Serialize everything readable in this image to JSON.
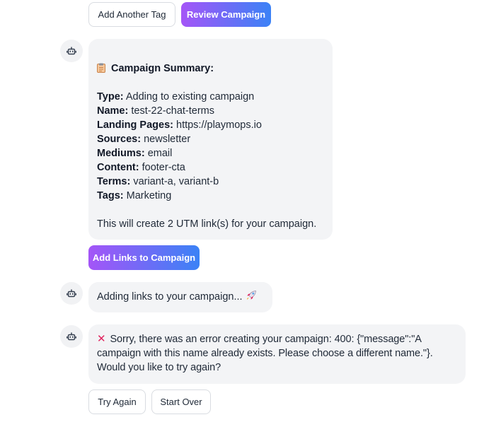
{
  "top_actions": {
    "add_tag_label": "Add Another Tag",
    "review_label": "Review Campaign"
  },
  "summary": {
    "title": "Campaign Summary:",
    "fields": [
      {
        "label": "Type:",
        "value": "Adding to existing campaign"
      },
      {
        "label": "Name:",
        "value": "test-22-chat-terms"
      },
      {
        "label": "Landing Pages:",
        "value": "https://playmops.io"
      },
      {
        "label": "Sources:",
        "value": "newsletter"
      },
      {
        "label": "Mediums:",
        "value": "email"
      },
      {
        "label": "Content:",
        "value": "footer-cta"
      },
      {
        "label": "Terms:",
        "value": "variant-a, variant-b"
      },
      {
        "label": "Tags:",
        "value": "Marketing"
      }
    ],
    "footer": "This will create 2 UTM link(s) for your campaign.",
    "action_label": "Add Links to Campaign"
  },
  "progress_message": {
    "text": "Adding links to your campaign..."
  },
  "error_message": {
    "icon": "cross-mark-icon",
    "lines": [
      "Sorry, there was an error creating your campaign: 400: {\"message\":\"A",
      "campaign with this name already exists. Please choose a different name.\"}.",
      "Would you like to try again?"
    ],
    "try_again_label": "Try Again",
    "start_over_label": "Start Over"
  },
  "colors": {
    "gradient_start": "#a455f7",
    "gradient_end": "#3b82f6",
    "bubble_bg": "#f3f4f6",
    "avatar_bg": "#f1f2f4",
    "error_red": "#e0245e"
  }
}
